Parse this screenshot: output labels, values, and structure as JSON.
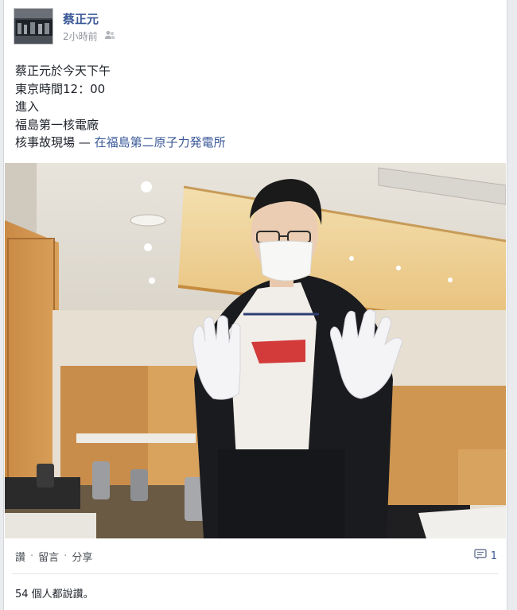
{
  "post": {
    "author": "蔡正元",
    "time": "2小時前",
    "privacy_icon": "friends-icon",
    "text_lines": [
      "蔡正元於今天下午",
      "東京時間12：00",
      "進入",
      "福島第一核電廠",
      "核事故現場"
    ],
    "location_separator": " — ",
    "location_link": "在福島第二原子力発電所"
  },
  "actions": {
    "like": "讚",
    "comment": "留言",
    "share": "分享",
    "separator": "·",
    "comment_icon": "comment-icon",
    "comment_count": "1"
  },
  "likes_text": "54 個人都說讚。",
  "colors": {
    "link": "#3b5998",
    "meta": "#90949c",
    "text": "#1d2129"
  }
}
